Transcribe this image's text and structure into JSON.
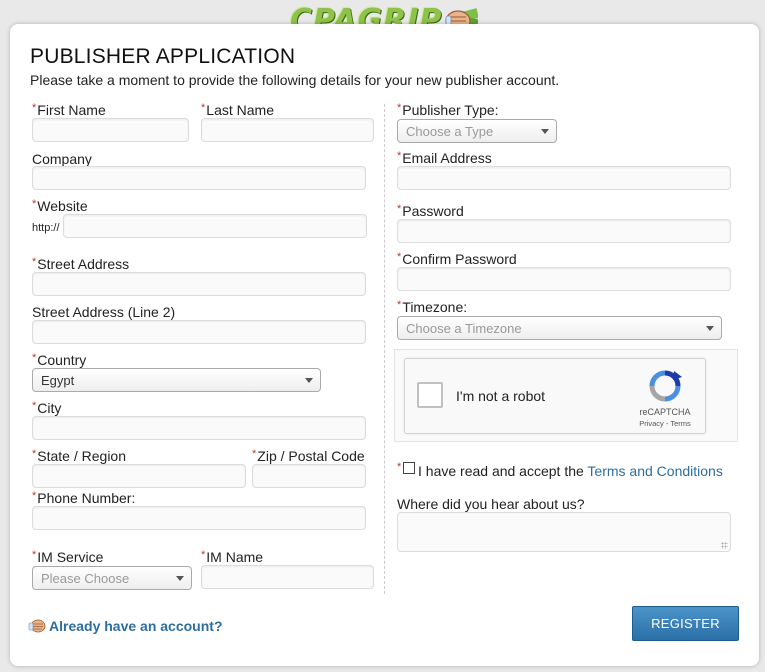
{
  "brand": {
    "logo_text": "CPAGRIP"
  },
  "header": {
    "title": "PUBLISHER APPLICATION",
    "subtitle": "Please take a moment to provide the following details for your new publisher account."
  },
  "required_marker": "*",
  "left": {
    "first_name_label": "First Name",
    "last_name_label": "Last Name",
    "company_label": "Company",
    "website_label": "Website",
    "website_prefix": "http://",
    "street_label": "Street Address",
    "street2_label": "Street Address (Line 2)",
    "country_label": "Country",
    "country_value": "Egypt",
    "city_label": "City",
    "state_label": "State / Region",
    "zip_label": "Zip / Postal Code",
    "phone_label": "Phone Number:",
    "im_service_label": "IM Service",
    "im_service_placeholder": "Please Choose",
    "im_name_label": "IM Name"
  },
  "right": {
    "publisher_type_label": "Publisher Type:",
    "publisher_type_placeholder": "Choose a Type",
    "email_label": "Email Address",
    "password_label": "Password",
    "confirm_password_label": "Confirm Password",
    "timezone_label": "Timezone:",
    "timezone_placeholder": "Choose a Timezone"
  },
  "captcha": {
    "text": "I'm not a robot",
    "brand": "reCAPTCHA",
    "links": "Privacy - Terms"
  },
  "terms": {
    "prefix": "I have read and accept the ",
    "link": "Terms and Conditions"
  },
  "hear_label": "Where did you hear about us?",
  "footer": {
    "have_account": "Already have an account?",
    "register_label": "REGISTER"
  },
  "colors": {
    "link": "#2e6e9e",
    "required": "#c0392b",
    "button": "#2b6fa6",
    "logo_green": "#8fc24a"
  }
}
